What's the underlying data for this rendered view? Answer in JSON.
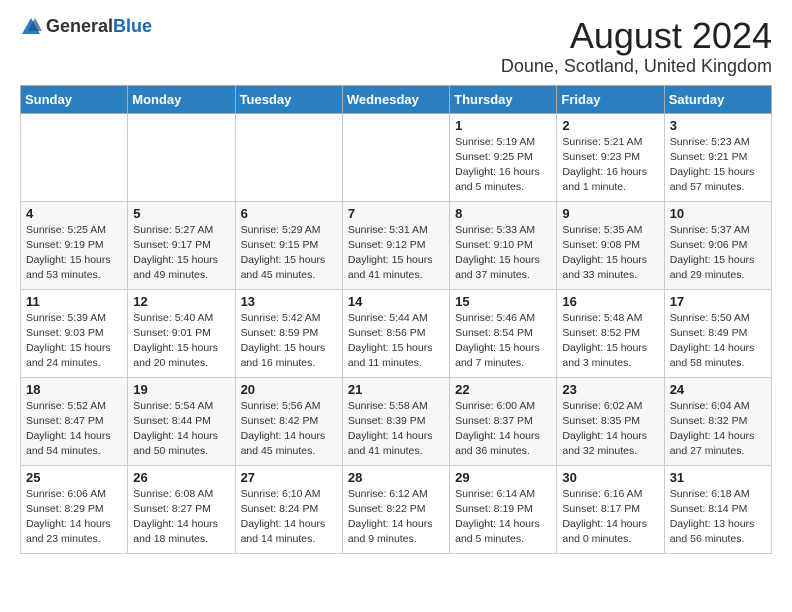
{
  "logo": {
    "text_general": "General",
    "text_blue": "Blue"
  },
  "title": "August 2024",
  "location": "Doune, Scotland, United Kingdom",
  "weekdays": [
    "Sunday",
    "Monday",
    "Tuesday",
    "Wednesday",
    "Thursday",
    "Friday",
    "Saturday"
  ],
  "weeks": [
    [
      {
        "day": "",
        "info": ""
      },
      {
        "day": "",
        "info": ""
      },
      {
        "day": "",
        "info": ""
      },
      {
        "day": "",
        "info": ""
      },
      {
        "day": "1",
        "info": "Sunrise: 5:19 AM\nSunset: 9:25 PM\nDaylight: 16 hours\nand 5 minutes."
      },
      {
        "day": "2",
        "info": "Sunrise: 5:21 AM\nSunset: 9:23 PM\nDaylight: 16 hours\nand 1 minute."
      },
      {
        "day": "3",
        "info": "Sunrise: 5:23 AM\nSunset: 9:21 PM\nDaylight: 15 hours\nand 57 minutes."
      }
    ],
    [
      {
        "day": "4",
        "info": "Sunrise: 5:25 AM\nSunset: 9:19 PM\nDaylight: 15 hours\nand 53 minutes."
      },
      {
        "day": "5",
        "info": "Sunrise: 5:27 AM\nSunset: 9:17 PM\nDaylight: 15 hours\nand 49 minutes."
      },
      {
        "day": "6",
        "info": "Sunrise: 5:29 AM\nSunset: 9:15 PM\nDaylight: 15 hours\nand 45 minutes."
      },
      {
        "day": "7",
        "info": "Sunrise: 5:31 AM\nSunset: 9:12 PM\nDaylight: 15 hours\nand 41 minutes."
      },
      {
        "day": "8",
        "info": "Sunrise: 5:33 AM\nSunset: 9:10 PM\nDaylight: 15 hours\nand 37 minutes."
      },
      {
        "day": "9",
        "info": "Sunrise: 5:35 AM\nSunset: 9:08 PM\nDaylight: 15 hours\nand 33 minutes."
      },
      {
        "day": "10",
        "info": "Sunrise: 5:37 AM\nSunset: 9:06 PM\nDaylight: 15 hours\nand 29 minutes."
      }
    ],
    [
      {
        "day": "11",
        "info": "Sunrise: 5:39 AM\nSunset: 9:03 PM\nDaylight: 15 hours\nand 24 minutes."
      },
      {
        "day": "12",
        "info": "Sunrise: 5:40 AM\nSunset: 9:01 PM\nDaylight: 15 hours\nand 20 minutes."
      },
      {
        "day": "13",
        "info": "Sunrise: 5:42 AM\nSunset: 8:59 PM\nDaylight: 15 hours\nand 16 minutes."
      },
      {
        "day": "14",
        "info": "Sunrise: 5:44 AM\nSunset: 8:56 PM\nDaylight: 15 hours\nand 11 minutes."
      },
      {
        "day": "15",
        "info": "Sunrise: 5:46 AM\nSunset: 8:54 PM\nDaylight: 15 hours\nand 7 minutes."
      },
      {
        "day": "16",
        "info": "Sunrise: 5:48 AM\nSunset: 8:52 PM\nDaylight: 15 hours\nand 3 minutes."
      },
      {
        "day": "17",
        "info": "Sunrise: 5:50 AM\nSunset: 8:49 PM\nDaylight: 14 hours\nand 58 minutes."
      }
    ],
    [
      {
        "day": "18",
        "info": "Sunrise: 5:52 AM\nSunset: 8:47 PM\nDaylight: 14 hours\nand 54 minutes."
      },
      {
        "day": "19",
        "info": "Sunrise: 5:54 AM\nSunset: 8:44 PM\nDaylight: 14 hours\nand 50 minutes."
      },
      {
        "day": "20",
        "info": "Sunrise: 5:56 AM\nSunset: 8:42 PM\nDaylight: 14 hours\nand 45 minutes."
      },
      {
        "day": "21",
        "info": "Sunrise: 5:58 AM\nSunset: 8:39 PM\nDaylight: 14 hours\nand 41 minutes."
      },
      {
        "day": "22",
        "info": "Sunrise: 6:00 AM\nSunset: 8:37 PM\nDaylight: 14 hours\nand 36 minutes."
      },
      {
        "day": "23",
        "info": "Sunrise: 6:02 AM\nSunset: 8:35 PM\nDaylight: 14 hours\nand 32 minutes."
      },
      {
        "day": "24",
        "info": "Sunrise: 6:04 AM\nSunset: 8:32 PM\nDaylight: 14 hours\nand 27 minutes."
      }
    ],
    [
      {
        "day": "25",
        "info": "Sunrise: 6:06 AM\nSunset: 8:29 PM\nDaylight: 14 hours\nand 23 minutes."
      },
      {
        "day": "26",
        "info": "Sunrise: 6:08 AM\nSunset: 8:27 PM\nDaylight: 14 hours\nand 18 minutes."
      },
      {
        "day": "27",
        "info": "Sunrise: 6:10 AM\nSunset: 8:24 PM\nDaylight: 14 hours\nand 14 minutes."
      },
      {
        "day": "28",
        "info": "Sunrise: 6:12 AM\nSunset: 8:22 PM\nDaylight: 14 hours\nand 9 minutes."
      },
      {
        "day": "29",
        "info": "Sunrise: 6:14 AM\nSunset: 8:19 PM\nDaylight: 14 hours\nand 5 minutes."
      },
      {
        "day": "30",
        "info": "Sunrise: 6:16 AM\nSunset: 8:17 PM\nDaylight: 14 hours\nand 0 minutes."
      },
      {
        "day": "31",
        "info": "Sunrise: 6:18 AM\nSunset: 8:14 PM\nDaylight: 13 hours\nand 56 minutes."
      }
    ]
  ]
}
